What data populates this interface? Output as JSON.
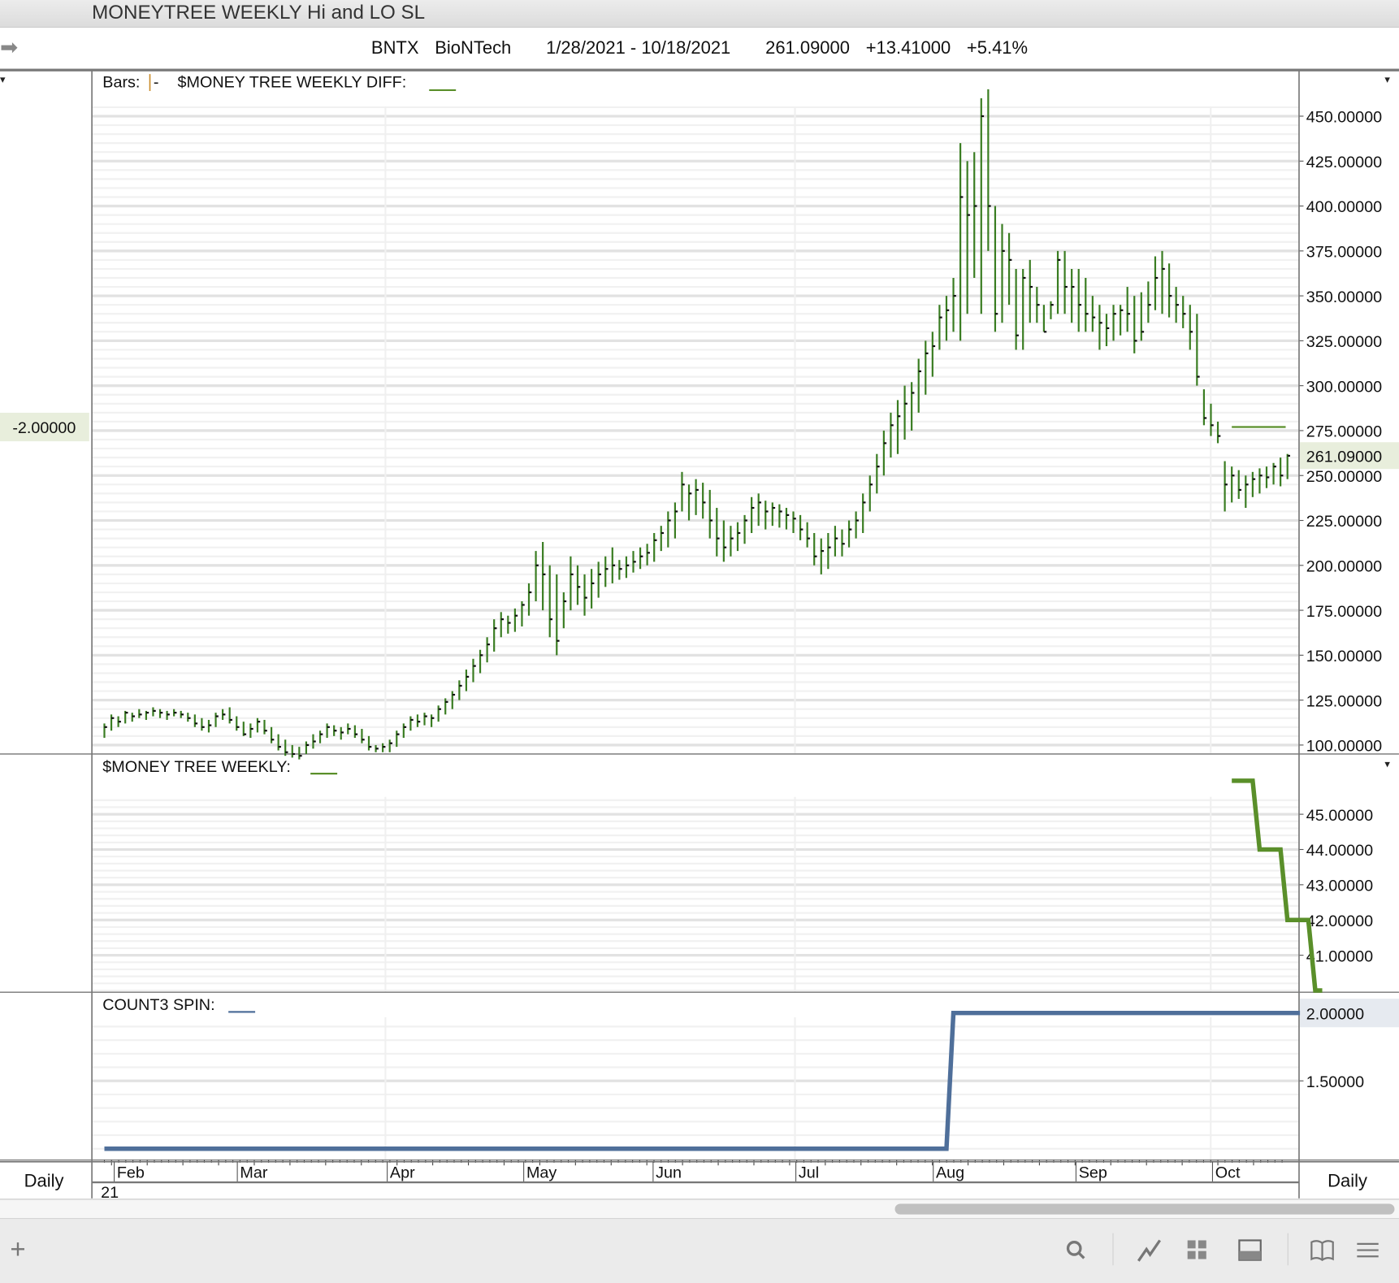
{
  "window": {
    "title": "MONEYTREE WEEKLY Hi and LO SL"
  },
  "header": {
    "symbol": "BNTX",
    "name": "BioNTech",
    "date_range": "1/28/2021 - 10/18/2021",
    "last": "261.09000",
    "change": "+13.41000",
    "change_pct": "+5.41%"
  },
  "panels": {
    "price": {
      "legend_bars": "Bars:",
      "legend_name": "$MONEY TREE WEEKLY DIFF:",
      "left_value_label": "-2.00000",
      "last_price_label": "261.09000"
    },
    "mtw": {
      "legend_name": "$MONEY TREE WEEKLY:"
    },
    "count": {
      "legend_name": "COUNT3 SPIN:",
      "last_value_label": "2.00000"
    }
  },
  "xaxis": {
    "months": [
      "Feb",
      "Mar",
      "Apr",
      "May",
      "Jun",
      "Jul",
      "Aug",
      "Sep",
      "Oct"
    ],
    "year": "21",
    "period_left": "Daily",
    "period_right": "Daily"
  },
  "colors": {
    "bars": "#3a7d22",
    "mtw": "#5a8f2a",
    "count": "#4f6f9a",
    "grid": "#ececec"
  },
  "toolbar": {
    "icons": [
      "plus-icon",
      "search-icon",
      "line-chart-icon",
      "grid-icon",
      "layout-icon",
      "book-icon",
      "menu-icon"
    ]
  },
  "chart_data": [
    {
      "type": "bar-ohlc",
      "title": "$MONEY TREE WEEKLY DIFF",
      "ylim": [
        95,
        465
      ],
      "yticks": [
        "450.00000",
        "425.00000",
        "400.00000",
        "375.00000",
        "350.00000",
        "325.00000",
        "300.00000",
        "275.00000",
        "250.00000",
        "225.00000",
        "200.00000",
        "175.00000",
        "150.00000",
        "125.00000",
        "100.00000"
      ],
      "ytick_values": [
        450,
        425,
        400,
        375,
        350,
        325,
        300,
        275,
        250,
        225,
        200,
        175,
        150,
        125,
        100
      ],
      "diff_level": 277,
      "diff_line_start_index": 162,
      "bars_hlc": [
        [
          112,
          104,
          110
        ],
        [
          117,
          108,
          115
        ],
        [
          116,
          110,
          113
        ],
        [
          119,
          112,
          118
        ],
        [
          118,
          113,
          116
        ],
        [
          120,
          115,
          117
        ],
        [
          119,
          114,
          118
        ],
        [
          121,
          116,
          119
        ],
        [
          120,
          115,
          118
        ],
        [
          119,
          114,
          117
        ],
        [
          120,
          116,
          118
        ],
        [
          119,
          115,
          117
        ],
        [
          118,
          113,
          115
        ],
        [
          117,
          110,
          112
        ],
        [
          115,
          108,
          110
        ],
        [
          114,
          107,
          111
        ],
        [
          118,
          110,
          116
        ],
        [
          120,
          114,
          117
        ],
        [
          121,
          112,
          114
        ],
        [
          116,
          108,
          110
        ],
        [
          113,
          105,
          106
        ],
        [
          112,
          104,
          109
        ],
        [
          115,
          107,
          113
        ],
        [
          114,
          106,
          108
        ],
        [
          110,
          101,
          103
        ],
        [
          106,
          97,
          99
        ],
        [
          103,
          94,
          96
        ],
        [
          100,
          93,
          95
        ],
        [
          99,
          92,
          94
        ],
        [
          102,
          95,
          100
        ],
        [
          106,
          98,
          102
        ],
        [
          108,
          101,
          106
        ],
        [
          112,
          104,
          110
        ],
        [
          111,
          105,
          108
        ],
        [
          110,
          103,
          107
        ],
        [
          112,
          106,
          109
        ],
        [
          111,
          104,
          106
        ],
        [
          109,
          101,
          103
        ],
        [
          105,
          97,
          99
        ],
        [
          100,
          96,
          98
        ],
        [
          101,
          96,
          99
        ],
        [
          103,
          96,
          101
        ],
        [
          108,
          99,
          106
        ],
        [
          112,
          104,
          110
        ],
        [
          116,
          108,
          114
        ],
        [
          117,
          110,
          113
        ],
        [
          118,
          111,
          116
        ],
        [
          117,
          110,
          115
        ],
        [
          122,
          113,
          120
        ],
        [
          126,
          117,
          124
        ],
        [
          130,
          120,
          128
        ],
        [
          136,
          125,
          133
        ],
        [
          142,
          130,
          138
        ],
        [
          148,
          135,
          144
        ],
        [
          153,
          140,
          150
        ],
        [
          160,
          146,
          156
        ],
        [
          170,
          152,
          165
        ],
        [
          174,
          160,
          170
        ],
        [
          172,
          162,
          168
        ],
        [
          176,
          163,
          172
        ],
        [
          180,
          166,
          178
        ],
        [
          190,
          172,
          185
        ],
        [
          208,
          180,
          200
        ],
        [
          213,
          175,
          195
        ],
        [
          200,
          160,
          170
        ],
        [
          195,
          150,
          158
        ],
        [
          185,
          165,
          180
        ],
        [
          205,
          175,
          195
        ],
        [
          200,
          178,
          188
        ],
        [
          195,
          172,
          182
        ],
        [
          198,
          176,
          190
        ],
        [
          202,
          182,
          195
        ],
        [
          205,
          188,
          198
        ],
        [
          210,
          190,
          200
        ],
        [
          203,
          192,
          198
        ],
        [
          205,
          193,
          200
        ],
        [
          208,
          196,
          202
        ],
        [
          210,
          198,
          205
        ],
        [
          212,
          200,
          207
        ],
        [
          218,
          202,
          214
        ],
        [
          222,
          208,
          218
        ],
        [
          230,
          210,
          225
        ],
        [
          235,
          215,
          230
        ],
        [
          252,
          230,
          245
        ],
        [
          245,
          225,
          240
        ],
        [
          248,
          228,
          242
        ],
        [
          246,
          226,
          235
        ],
        [
          242,
          215,
          225
        ],
        [
          232,
          205,
          215
        ],
        [
          225,
          202,
          210
        ],
        [
          222,
          205,
          215
        ],
        [
          224,
          208,
          218
        ],
        [
          228,
          212,
          225
        ],
        [
          238,
          218,
          232
        ],
        [
          240,
          222,
          235
        ],
        [
          236,
          220,
          230
        ],
        [
          235,
          222,
          232
        ],
        [
          234,
          221,
          230
        ],
        [
          232,
          220,
          228
        ],
        [
          230,
          218,
          226
        ],
        [
          228,
          214,
          220
        ],
        [
          224,
          210,
          215
        ],
        [
          218,
          200,
          205
        ],
        [
          215,
          195,
          208
        ],
        [
          218,
          198,
          210
        ],
        [
          222,
          205,
          215
        ],
        [
          220,
          205,
          212
        ],
        [
          225,
          210,
          220
        ],
        [
          230,
          215,
          225
        ],
        [
          240,
          218,
          235
        ],
        [
          250,
          230,
          245
        ],
        [
          262,
          240,
          255
        ],
        [
          275,
          250,
          268
        ],
        [
          285,
          260,
          278
        ],
        [
          292,
          262,
          283
        ],
        [
          300,
          270,
          290
        ],
        [
          302,
          275,
          296
        ],
        [
          315,
          285,
          308
        ],
        [
          325,
          295,
          318
        ],
        [
          330,
          305,
          322
        ],
        [
          345,
          320,
          338
        ],
        [
          350,
          325,
          342
        ],
        [
          360,
          330,
          350
        ],
        [
          435,
          325,
          405
        ],
        [
          425,
          340,
          395
        ],
        [
          430,
          360,
          400
        ],
        [
          460,
          340,
          450
        ],
        [
          465,
          375,
          400
        ],
        [
          400,
          330,
          340
        ],
        [
          390,
          335,
          375
        ],
        [
          385,
          345,
          370
        ],
        [
          365,
          320,
          328
        ],
        [
          365,
          320,
          360
        ],
        [
          370,
          335,
          355
        ],
        [
          355,
          335,
          345
        ],
        [
          345,
          330,
          330
        ],
        [
          347,
          337,
          345
        ],
        [
          375,
          340,
          370
        ],
        [
          375,
          340,
          355
        ],
        [
          365,
          335,
          355
        ],
        [
          365,
          330,
          345
        ],
        [
          360,
          330,
          340
        ],
        [
          350,
          330,
          338
        ],
        [
          345,
          320,
          335
        ],
        [
          340,
          322,
          332
        ],
        [
          345,
          325,
          340
        ],
        [
          345,
          328,
          342
        ],
        [
          355,
          330,
          340
        ],
        [
          350,
          318,
          325
        ],
        [
          352,
          325,
          330
        ],
        [
          358,
          335,
          345
        ],
        [
          372,
          342,
          360
        ],
        [
          375,
          340,
          365
        ],
        [
          368,
          338,
          350
        ],
        [
          355,
          335,
          345
        ],
        [
          350,
          332,
          340
        ],
        [
          345,
          320,
          330
        ],
        [
          340,
          300,
          305
        ],
        [
          298,
          278,
          282
        ],
        [
          290,
          272,
          278
        ],
        [
          280,
          268,
          272
        ],
        [
          258,
          230,
          245
        ],
        [
          255,
          235,
          250
        ],
        [
          253,
          237,
          242
        ],
        [
          250,
          232,
          245
        ],
        [
          252,
          238,
          248
        ],
        [
          254,
          240,
          250
        ],
        [
          255,
          243,
          249
        ],
        [
          257,
          245,
          255
        ],
        [
          260,
          244,
          250
        ],
        [
          262,
          248,
          261
        ]
      ]
    },
    {
      "type": "line-step",
      "title": "$MONEY TREE WEEKLY",
      "ylim": [
        40.0,
        46.0
      ],
      "yticks": [
        "45.00000",
        "44.00000",
        "43.00000",
        "42.00000",
        "41.00000"
      ],
      "ytick_values": [
        45,
        44,
        43,
        42,
        41
      ],
      "points": [
        [
          162,
          45.95
        ],
        [
          165,
          45.95
        ],
        [
          166,
          44.0
        ],
        [
          169,
          44.0
        ],
        [
          170,
          42.0
        ],
        [
          173,
          42.0
        ],
        [
          174,
          40.0
        ],
        [
          175,
          40.0
        ]
      ]
    },
    {
      "type": "line-step",
      "title": "COUNT3 SPIN",
      "ylim": [
        0.93,
        2.1
      ],
      "yticks": [
        "1.50000"
      ],
      "ytick_values": [
        1.5
      ],
      "points": [
        [
          0,
          1.0
        ],
        [
          121,
          1.0
        ],
        [
          122,
          2.0
        ],
        [
          175,
          2.0
        ]
      ]
    }
  ]
}
